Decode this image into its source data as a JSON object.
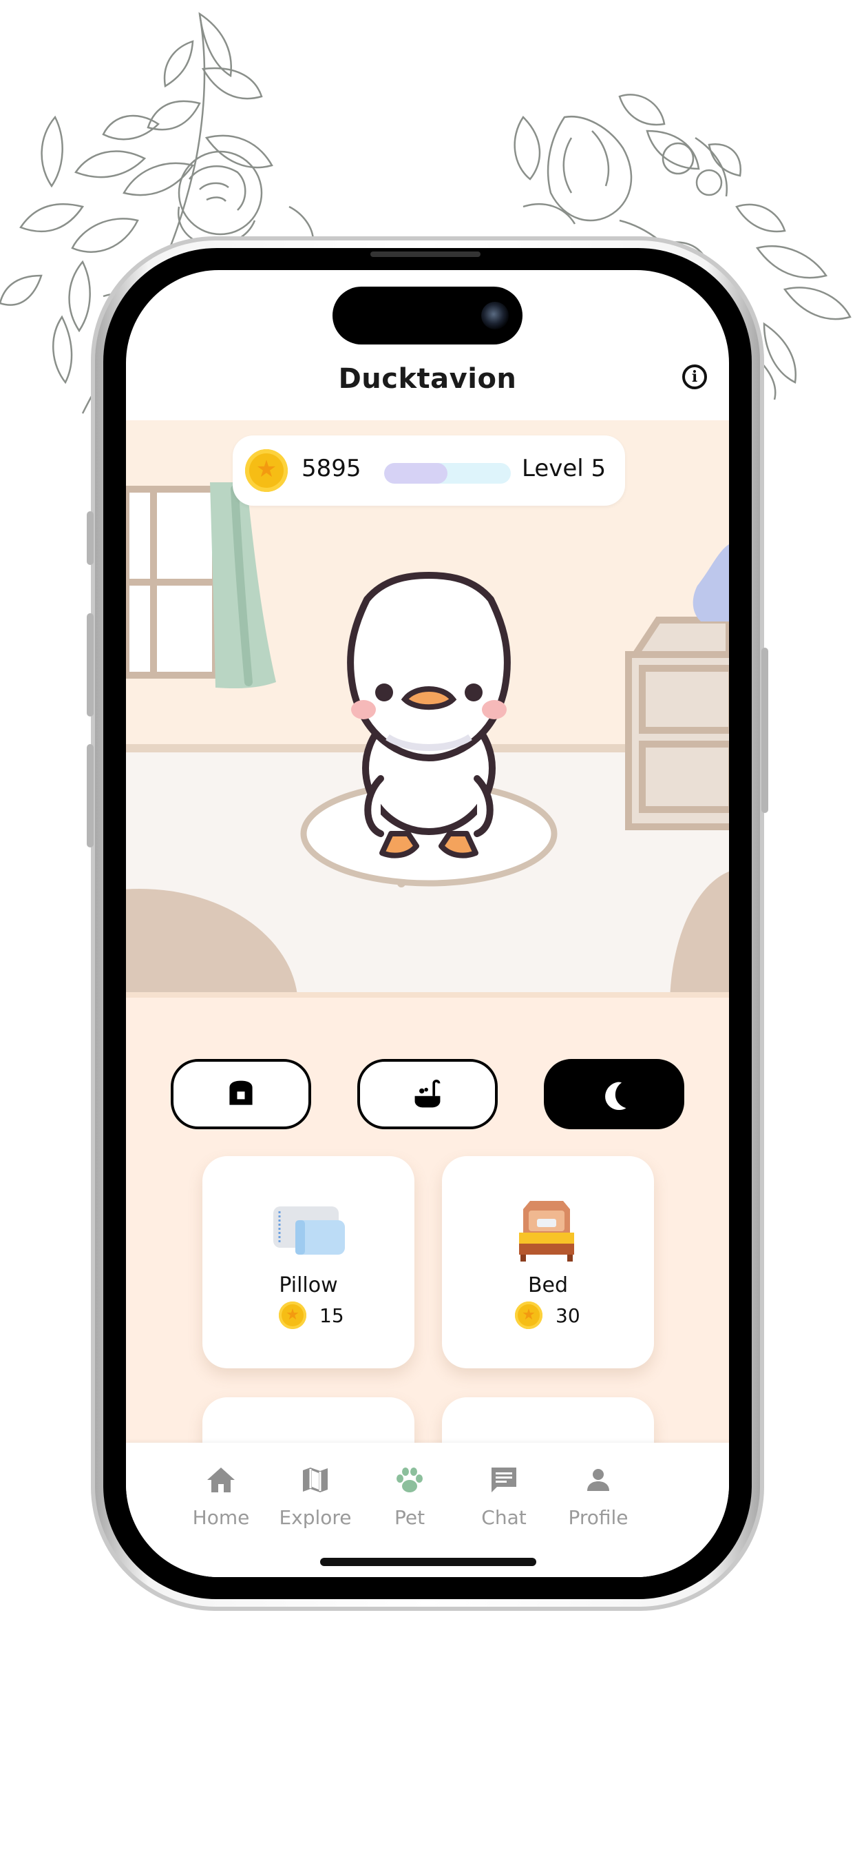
{
  "app": {
    "title": "Ducktavion",
    "info_icon": "info-icon"
  },
  "status": {
    "coins": "5895",
    "level": "Level 5",
    "xp_progress": 0.5,
    "coin_icon": "coin-star-icon"
  },
  "pet": {
    "character": "white-duck",
    "scene": "bedroom"
  },
  "categories": [
    {
      "icon": "toast-icon",
      "active": false
    },
    {
      "icon": "bathtub-icon",
      "active": false
    },
    {
      "icon": "moon-icon",
      "active": true
    }
  ],
  "items": [
    {
      "name": "Pillow",
      "price": "15",
      "icon": "pillow-icon"
    },
    {
      "name": "Bed",
      "price": "30",
      "icon": "bed-icon"
    }
  ],
  "nav": [
    {
      "label": "Home",
      "icon": "home-icon",
      "active": false
    },
    {
      "label": "Explore",
      "icon": "map-icon",
      "active": false
    },
    {
      "label": "Pet",
      "icon": "paw-icon",
      "active": true
    },
    {
      "label": "Chat",
      "icon": "chat-icon",
      "active": false
    },
    {
      "label": "Profile",
      "icon": "person-icon",
      "active": false
    }
  ],
  "colors": {
    "background_room": "#fdefe2",
    "content_bg": "#ffeee2",
    "coin": "#f6bd15",
    "xp_fill": "#d6d2f5",
    "xp_track": "#def4fb",
    "nav_active": "#8cbf9c",
    "nav_inactive": "#8f8f8f"
  }
}
